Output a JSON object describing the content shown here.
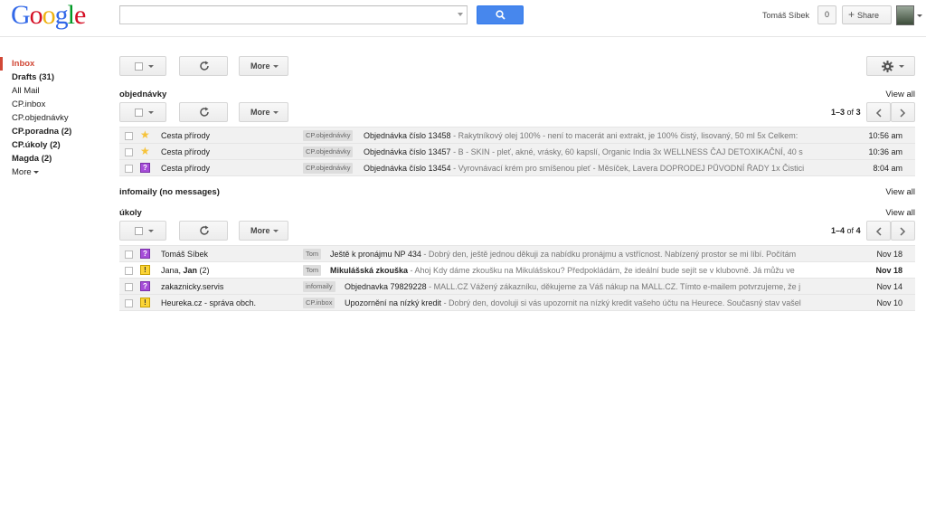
{
  "header": {
    "logo_letters": [
      {
        "ch": "G",
        "color": "#3369e8"
      },
      {
        "ch": "o",
        "color": "#d50f25"
      },
      {
        "ch": "o",
        "color": "#eeb211"
      },
      {
        "ch": "g",
        "color": "#3369e8"
      },
      {
        "ch": "l",
        "color": "#009925"
      },
      {
        "ch": "e",
        "color": "#d50f25"
      }
    ],
    "search_value": "",
    "user_name": "Tomáš Síbek",
    "notification_count": "0",
    "share_label": "Share"
  },
  "sidebar": {
    "items": [
      {
        "label": "Inbox"
      },
      {
        "label": "Drafts (31)"
      },
      {
        "label": "All Mail"
      },
      {
        "label": "CP.inbox"
      },
      {
        "label": "CP.objednávky"
      },
      {
        "label": "CP.poradna (2)"
      },
      {
        "label": "CP.úkoly (2)"
      },
      {
        "label": "Magda (2)"
      },
      {
        "label": "More"
      }
    ]
  },
  "toolbar": {
    "more_label": "More"
  },
  "sections": {
    "objednavky": {
      "title": "objednávky",
      "view_all": "View all",
      "pager": {
        "range": "1–3",
        "of": "of",
        "total": "3"
      },
      "rows": [
        {
          "sender": "Cesta přírody",
          "label": "CP.objednávky",
          "subject": "Objednávka číslo 13458",
          "snippet": " - Rakytníkový olej 100% - není to macerát ani extrakt, je 100% čistý, lisovaný, 50 ml 5x Celkem:",
          "date": "10:56 am"
        },
        {
          "sender": "Cesta přírody",
          "label": "CP.objednávky",
          "subject": "Objednávka číslo 13457",
          "snippet": " - B - SKIN - pleť, akné, vrásky, 60 kapslí, Organic India 3x WELLNESS ČAJ DETOXIKAČNÍ, 40 s",
          "date": "10:36 am"
        },
        {
          "sender": "Cesta přírody",
          "label": "CP.objednávky",
          "subject": "Objednávka číslo 13454",
          "snippet": " - Vyrovnávací krém pro smíšenou pleť - Měsíček, Lavera DOPRODEJ PŮVODNÍ ŘADY 1x Čistici",
          "date": "8:04 am"
        }
      ]
    },
    "infomaily": {
      "title": "infomaily (no messages)",
      "view_all": "View all"
    },
    "ukoly": {
      "title": "úkoly",
      "view_all": "View all",
      "pager": {
        "range": "1–4",
        "of": "of",
        "total": "4"
      },
      "rows": [
        {
          "sender": "Tomáš Síbek",
          "sender_count": "",
          "label": "Tom",
          "subject": "Ještě k pronájmu NP 434",
          "snippet": " - Dobrý den, ještě jednou děkuji za nabídku pronájmu a vstřícnost. Nabízený prostor se mi líbí. Počítám",
          "date": "Nov 18"
        },
        {
          "sender": "Jana, ",
          "sender_bold": "Jan",
          "sender_count": " (2)",
          "label": "Tom",
          "subject": "Mikulášská zkouška",
          "snippet": " - Ahoj Kdy dáme zkoušku na Mikulášskou? Předpokládám, že ideální bude sejít se v klubovně. Já můžu ve",
          "date": "Nov 18"
        },
        {
          "sender": "zakaznicky.servis",
          "sender_count": "",
          "label": "infomaily",
          "subject": "Objednavka 79829228",
          "snippet": " - MALL.CZ Vážený zákazníku, děkujeme za Váš nákup na MALL.CZ. Tímto e-mailem potvrzujeme, že j",
          "date": "Nov 14"
        },
        {
          "sender": "Heureka.cz - správa obch.",
          "sender_count": "",
          "label": "CP.inbox",
          "subject": "Upozornění na nízký kredit",
          "snippet": " - Dobrý den, dovoluji si vás upozornit na nízký kredit vašeho účtu na Heurece. Současný stav vašel",
          "date": "Nov 10"
        }
      ]
    }
  }
}
